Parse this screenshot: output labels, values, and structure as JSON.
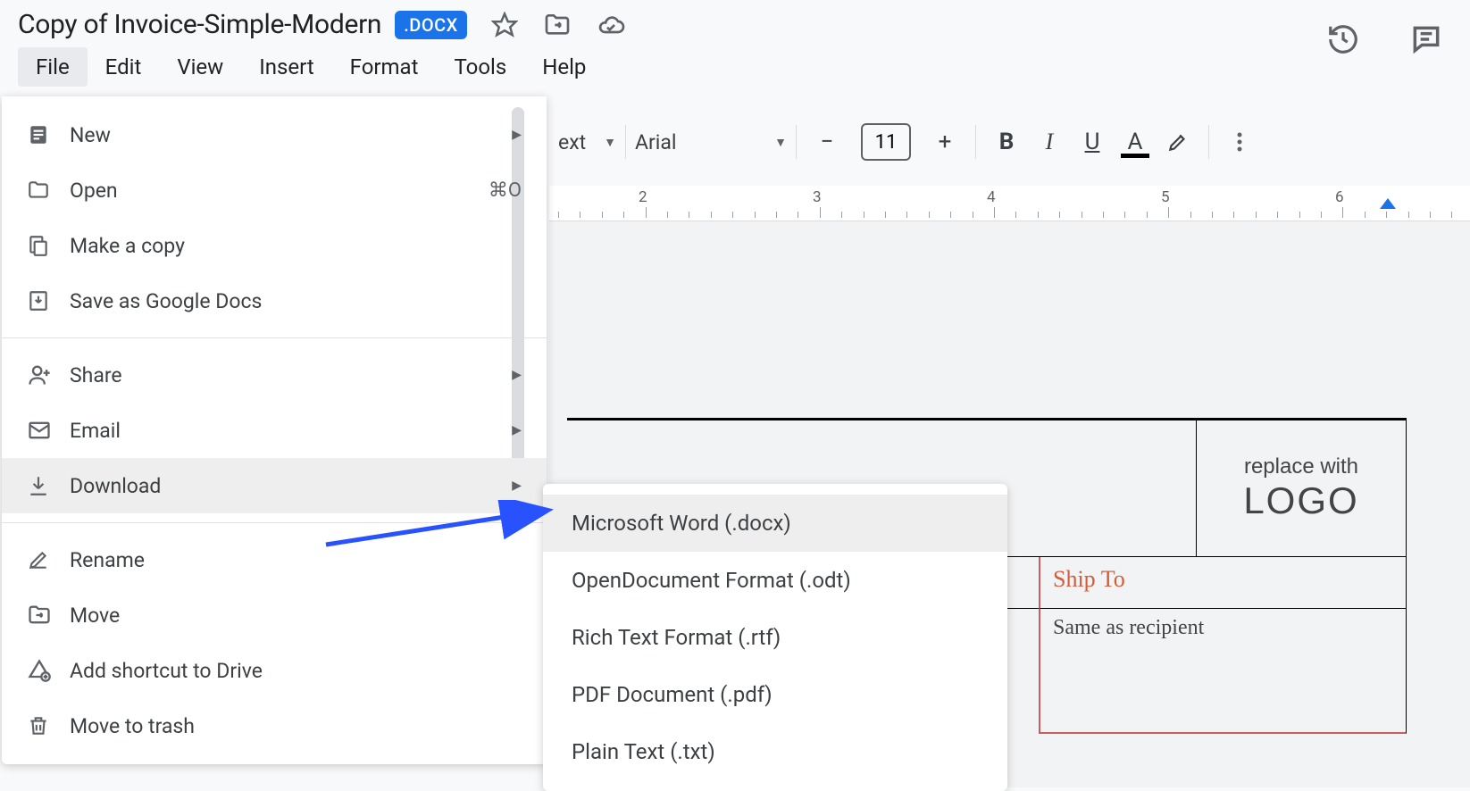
{
  "doc": {
    "title": "Copy of Invoice-Simple-Modern",
    "badge": ".DOCX"
  },
  "menubar": {
    "items": [
      "File",
      "Edit",
      "View",
      "Insert",
      "Format",
      "Tools",
      "Help"
    ]
  },
  "fileMenu": {
    "new": "New",
    "open": "Open",
    "openShortcut": "⌘O",
    "makeCopy": "Make a copy",
    "saveAs": "Save as Google Docs",
    "share": "Share",
    "email": "Email",
    "download": "Download",
    "rename": "Rename",
    "move": "Move",
    "addShortcut": "Add shortcut to Drive",
    "moveTrash": "Move to trash"
  },
  "downloadSubmenu": {
    "docx": "Microsoft Word (.docx)",
    "odt": "OpenDocument Format (.odt)",
    "rtf": "Rich Text Format (.rtf)",
    "pdf": "PDF Document (.pdf)",
    "txt": "Plain Text (.txt)"
  },
  "toolbar": {
    "styleHint": "ext",
    "font": "Arial",
    "fontSize": "11",
    "bold": "B",
    "italic": "I",
    "underline": "U",
    "textColor": "A"
  },
  "ruler": {
    "labels": [
      "2",
      "3",
      "4",
      "5",
      "6"
    ]
  },
  "invoice": {
    "logoLine1": "replace with",
    "logoLine2": "LOGO",
    "shipTo": "Ship To",
    "shipBody": "Same as recipient"
  }
}
